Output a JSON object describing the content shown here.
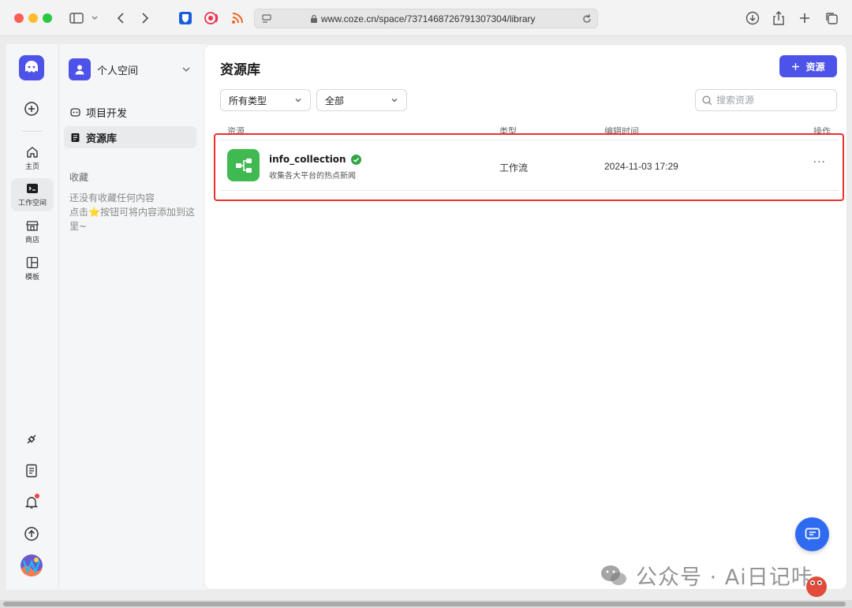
{
  "browser": {
    "url": "www.coze.cn/space/7371468726791307304/library"
  },
  "rail": {
    "items": [
      {
        "label": "主页"
      },
      {
        "label": "工作空间"
      },
      {
        "label": "商店"
      },
      {
        "label": "模板"
      }
    ]
  },
  "sidebar": {
    "space_name": "个人空间",
    "items": [
      {
        "label": "项目开发"
      },
      {
        "label": "资源库"
      }
    ],
    "favorites_title": "收藏",
    "favorites_empty_line1": "还没有收藏任何内容",
    "favorites_empty_line2_pre": "点击",
    "favorites_empty_star": "⭐",
    "favorites_empty_line2_post": "按钮可将内容添加到这里~"
  },
  "main": {
    "title": "资源库",
    "add_button_label": "资源",
    "filter_type": "所有类型",
    "filter_scope": "全部",
    "search_placeholder": "搜索资源",
    "columns": {
      "resource": "资源",
      "type": "类型",
      "edit_time": "编辑时间",
      "actions": "操作"
    },
    "rows": [
      {
        "name": "info_collection",
        "description": "收集各大平台的热点新闻",
        "type": "工作流",
        "edit_time": "2024-11-03 17:29",
        "more": "···"
      }
    ]
  },
  "watermark": {
    "text": "公众号 · Ai日记咔"
  },
  "colors": {
    "brand": "#4d53e8",
    "workflow_icon": "#3fb950",
    "highlight": "#ee2f2f",
    "chat_fab": "#2f6bf0"
  }
}
